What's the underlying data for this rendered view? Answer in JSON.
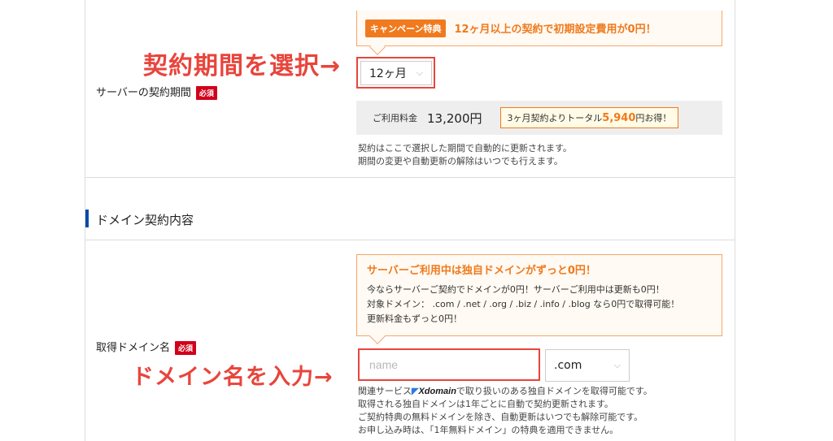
{
  "campaign": {
    "tag": "キャンペーン特典",
    "text": "12ヶ月以上の契約で初期設定費用が0円！"
  },
  "annotations": {
    "select_period": "契約期間を選択→",
    "enter_domain": "ドメイン名を入力→"
  },
  "server_period": {
    "label": "サーバーの契約期間",
    "required_badge": "必須",
    "selected": "12ヶ月",
    "fee_label": "ご利用料金",
    "fee_value": "13,200円",
    "note_prefix": "3ヶ月契約よりトータル",
    "note_amount": "5,940",
    "note_suffix": "円お得！",
    "help_lines": [
      "契約はここで選択した期間で自動的に更新されます。",
      "期間の変更や自動更新の解除はいつでも行えます。"
    ]
  },
  "domain_section": {
    "title": "ドメイン契約内容",
    "promo_title": "サーバーご利用中は独自ドメインがずっと0円！",
    "promo_lines": [
      "今ならサーバーご契約でドメインが0円！サーバーご利用中は更新も0円！",
      "対象ドメイン： .com / .net / .org / .biz / .info / .blog なら0円で取得可能！",
      "更新料金もずっと0円！"
    ],
    "label": "取得ドメイン名",
    "required_badge": "必須",
    "input_placeholder": "name",
    "tld_selected": ".com",
    "service_prefix": "関連サービス",
    "service_logo": "Xdomain",
    "service_suffix": "で取り扱いのある独自ドメインを取得可能です。",
    "help_lines": [
      "取得される独自ドメインは1年ごとに自動で契約更新されます。",
      "ご契約特典の無料ドメインを除き、自動更新はいつでも解除可能です。",
      "お申し込み時は、「1年無料ドメイン」の特典を適用できません。"
    ]
  },
  "colors": {
    "accent_orange": "#f07a1d",
    "annotation_red": "#e8453c",
    "required_red": "#d0021b",
    "section_blue": "#0b4aa8"
  }
}
